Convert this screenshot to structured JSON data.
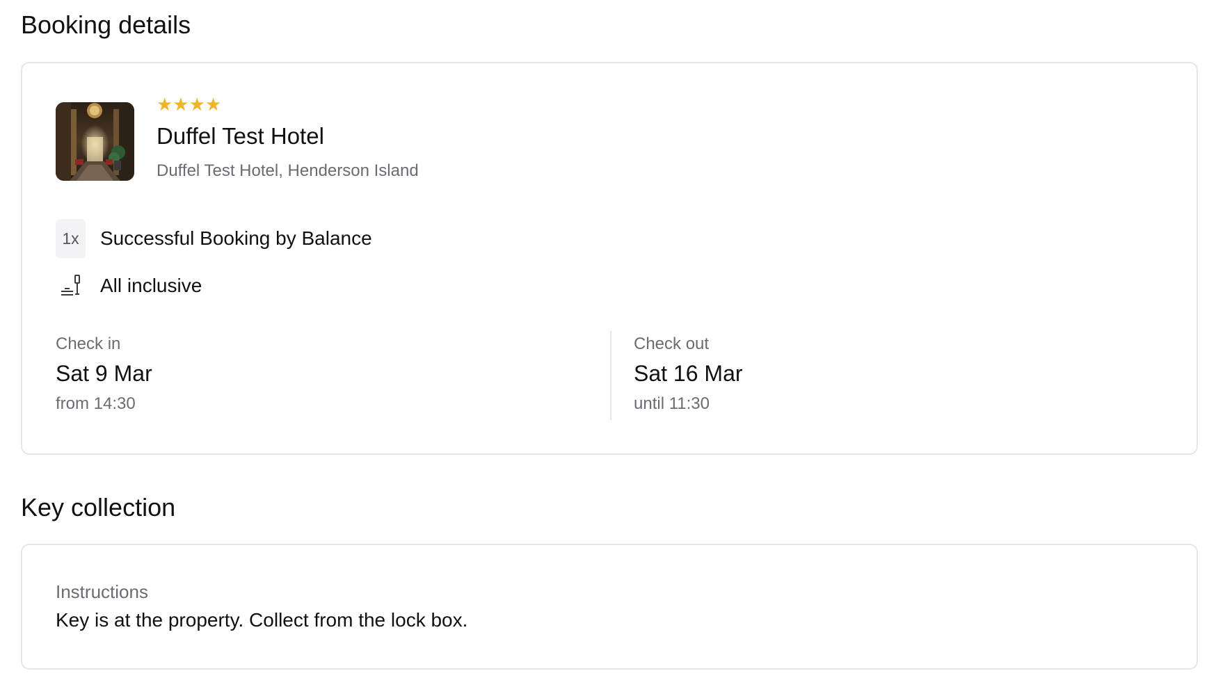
{
  "booking_details": {
    "title": "Booking details",
    "hotel": {
      "star_rating": 4,
      "stars_text": "★★★★",
      "name": "Duffel Test Hotel",
      "address": "Duffel Test Hotel, Henderson Island",
      "star_color": "#f0b429"
    },
    "room": {
      "quantity": "1x",
      "name": "Successful Booking by Balance"
    },
    "board": {
      "icon": "dining-icon",
      "label": "All inclusive"
    },
    "check_in": {
      "label": "Check in",
      "date": "Sat 9 Mar",
      "time": "from 14:30"
    },
    "check_out": {
      "label": "Check out",
      "date": "Sat 16 Mar",
      "time": "until 11:30"
    }
  },
  "key_collection": {
    "title": "Key collection",
    "instructions_label": "Instructions",
    "instructions_text": "Key is at the property. Collect from the lock box."
  }
}
